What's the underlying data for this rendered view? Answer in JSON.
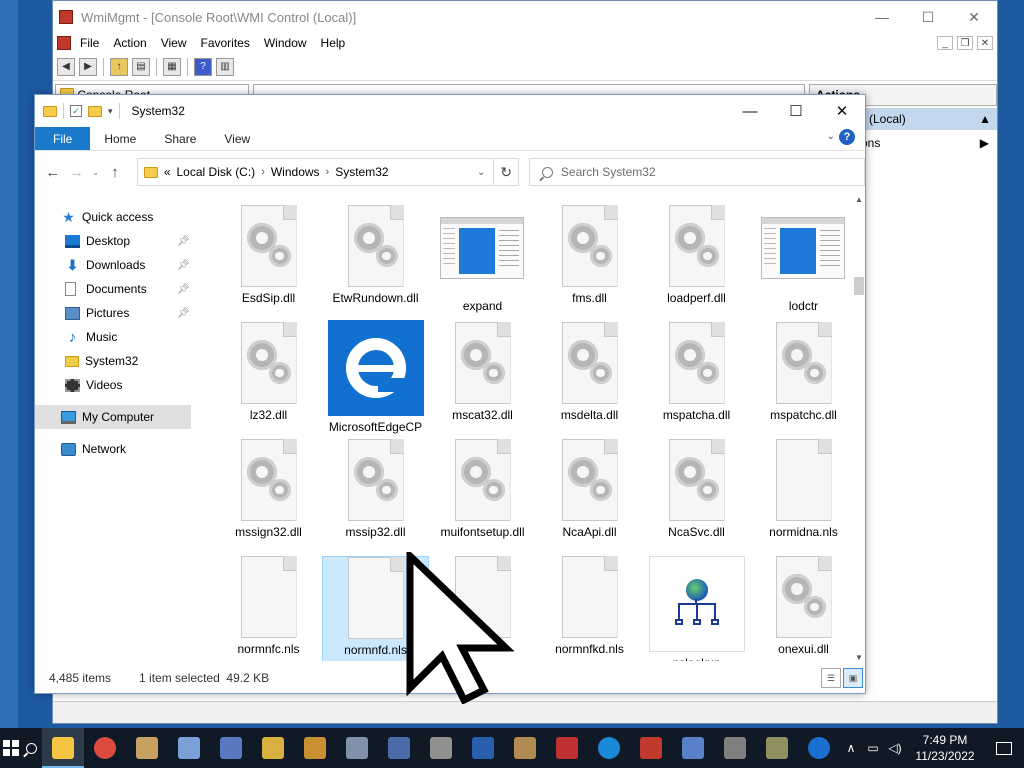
{
  "mmc": {
    "title": "WmiMgmt - [Console Root\\WMI Control (Local)]",
    "menu": [
      "File",
      "Action",
      "View",
      "Favorites",
      "Window",
      "Help"
    ],
    "tree_root": "Console Root",
    "actions_header": "Actions",
    "actions_selected": "trol (Local)",
    "actions_item": "Actions"
  },
  "explorer": {
    "title": "System32",
    "tabs": [
      "File",
      "Home",
      "Share",
      "View"
    ],
    "address": {
      "prefix": "«",
      "parts": [
        "Local Disk (C:)",
        "Windows",
        "System32"
      ]
    },
    "search_placeholder": "Search System32",
    "nav": {
      "quick_access": "Quick access",
      "items": [
        "Desktop",
        "Downloads",
        "Documents",
        "Pictures",
        "Music",
        "System32",
        "Videos"
      ],
      "my_computer": "My Computer",
      "network": "Network"
    },
    "files": [
      {
        "name": "EsdSip.dll",
        "icon": "dll-gear-icon"
      },
      {
        "name": "EtwRundown.dll",
        "icon": "dll-gear-icon"
      },
      {
        "name": "expand",
        "icon": "application-icon"
      },
      {
        "name": "fms.dll",
        "icon": "dll-gear-icon"
      },
      {
        "name": "loadperf.dll",
        "icon": "dll-gear-icon"
      },
      {
        "name": "lodctr",
        "icon": "application-icon"
      },
      {
        "name": "lz32.dll",
        "icon": "dll-gear-icon"
      },
      {
        "name": "MicrosoftEdgeCP",
        "icon": "edge-icon"
      },
      {
        "name": "mscat32.dll",
        "icon": "dll-gear-icon"
      },
      {
        "name": "msdelta.dll",
        "icon": "dll-gear-icon"
      },
      {
        "name": "mspatcha.dll",
        "icon": "dll-gear-icon"
      },
      {
        "name": "mspatchc.dll",
        "icon": "dll-gear-icon"
      },
      {
        "name": "mssign32.dll",
        "icon": "dll-gear-icon"
      },
      {
        "name": "mssip32.dll",
        "icon": "dll-gear-icon"
      },
      {
        "name": "muifontsetup.dll",
        "icon": "dll-gear-icon"
      },
      {
        "name": "NcaApi.dll",
        "icon": "dll-gear-icon"
      },
      {
        "name": "NcaSvc.dll",
        "icon": "dll-gear-icon"
      },
      {
        "name": "normidna.nls",
        "icon": "blank-file-icon"
      },
      {
        "name": "normnfc.nls",
        "icon": "blank-file-icon"
      },
      {
        "name": "normnfd.nls",
        "icon": "blank-file-icon",
        "selected": true
      },
      {
        "name": "",
        "icon": "blank-file-icon"
      },
      {
        "name": "normnfkd.nls",
        "icon": "blank-file-icon"
      },
      {
        "name": "nslookup",
        "icon": "nslookup-icon"
      },
      {
        "name": "onexui.dll",
        "icon": "dll-gear-icon"
      }
    ],
    "status": {
      "count": "4,485 items",
      "selection": "1 item selected  49.2 KB"
    }
  },
  "taskbar": {
    "clock_time": "7:49 PM",
    "clock_date": "11/23/2022",
    "apps": [
      {
        "name": "file-explorer",
        "color": "#f4c542",
        "active": true
      },
      {
        "name": "chrome",
        "color": "#dd4b3e"
      },
      {
        "name": "tool-1",
        "color": "#c8a060"
      },
      {
        "name": "tool-2",
        "color": "#7aa0d8"
      },
      {
        "name": "tool-3",
        "color": "#5a78c0"
      },
      {
        "name": "tool-4",
        "color": "#d8b040"
      },
      {
        "name": "tool-5",
        "color": "#c89030"
      },
      {
        "name": "tool-6",
        "color": "#8090a8"
      },
      {
        "name": "tool-7",
        "color": "#4a6aa8"
      },
      {
        "name": "tool-8",
        "color": "#909090"
      },
      {
        "name": "tool-9",
        "color": "#2a60b0"
      },
      {
        "name": "tool-10",
        "color": "#b08a50"
      },
      {
        "name": "tool-11",
        "color": "#c03030"
      },
      {
        "name": "internet-explorer",
        "color": "#1a8ad8"
      },
      {
        "name": "tool-12",
        "color": "#c03a30"
      },
      {
        "name": "tool-13",
        "color": "#5a80c8"
      },
      {
        "name": "tool-14",
        "color": "#808080"
      },
      {
        "name": "tool-15",
        "color": "#909060"
      },
      {
        "name": "bluetooth",
        "color": "#1a70d0"
      }
    ]
  }
}
